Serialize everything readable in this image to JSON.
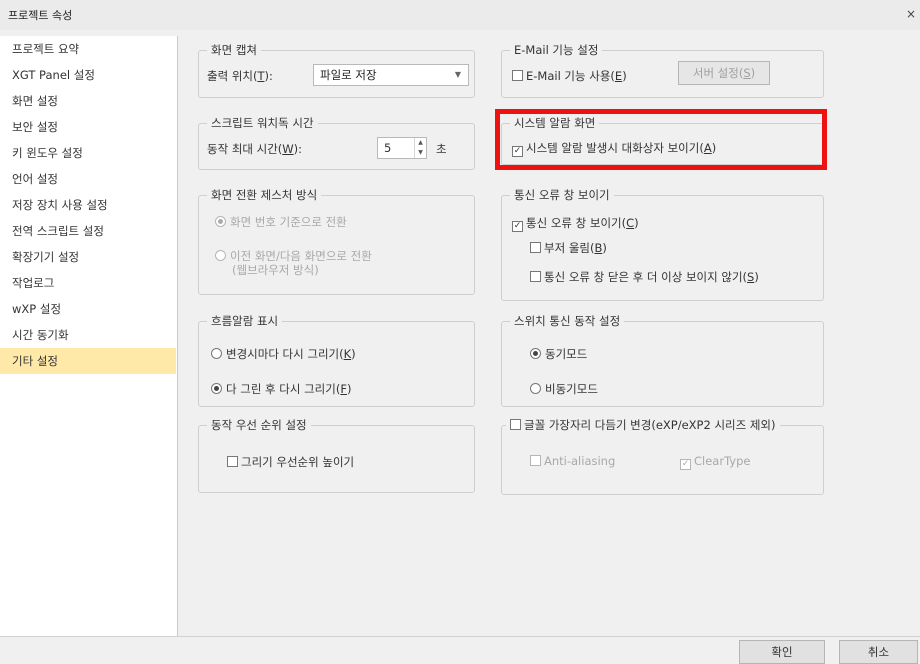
{
  "window": {
    "title": "프로젝트 속성",
    "close_glyph": "×"
  },
  "sidebar": {
    "items": [
      {
        "label": "프로젝트 요약"
      },
      {
        "label": "XGT Panel 설정"
      },
      {
        "label": "화면 설정"
      },
      {
        "label": "보안 설정"
      },
      {
        "label": "키 윈도우 설정"
      },
      {
        "label": "언어 설정"
      },
      {
        "label": "저장 장치 사용 설정"
      },
      {
        "label": "전역 스크립트 설정"
      },
      {
        "label": "확장기기 설정"
      },
      {
        "label": "작업로그"
      },
      {
        "label": "wXP 설정"
      },
      {
        "label": "시간 동기화"
      },
      {
        "label": "기타 설정",
        "selected": true
      }
    ]
  },
  "screen_capture": {
    "title": "화면 캡쳐",
    "output_label": "출력 위치(",
    "output_hotkey": "T",
    "output_suffix": "):",
    "output_value": "파일로 저장"
  },
  "email": {
    "title": "E-Mail 기능 설정",
    "use_label": "E-Mail 기능 사용(",
    "use_hotkey": "E",
    "use_suffix": ")",
    "server_button_label": "서버 설정(",
    "server_button_hotkey": "S",
    "server_button_suffix": ")"
  },
  "script_watchdog": {
    "title": "스크립트 워치독 시간",
    "max_time_label": "동작 최대 시간(",
    "max_time_hotkey": "W",
    "max_time_suffix": "):",
    "max_time_value": "5",
    "unit": "초"
  },
  "system_alarm": {
    "title": "시스템 알람 화면",
    "show_dialog_label": "시스템 알람 발생시 대화상자 보이기(",
    "show_dialog_hotkey": "A",
    "show_dialog_suffix": ")",
    "checked": true
  },
  "gesture": {
    "title": "화면 전환 제스처 방식",
    "option1": "화면 번호 기준으로 전환",
    "option2_line1": "이전 화면/다음 화면으로 전환",
    "option2_line2": "(웹브라우저 방식)"
  },
  "comm_error": {
    "title": "통신 오류 창 보이기",
    "show_label": "통신 오류 창 보이기(",
    "show_hotkey": "C",
    "show_suffix": ")",
    "buzzer_label": "부저 울림(",
    "buzzer_hotkey": "B",
    "buzzer_suffix": ")",
    "hide_label": "통신 오류 창 닫은 후 더 이상 보이지 않기(",
    "hide_hotkey": "S",
    "hide_suffix": ")"
  },
  "flow_alarm": {
    "title": "흐름알람 표시",
    "option1_label": "변경시마다 다시 그리기(",
    "option1_hotkey": "K",
    "option1_suffix": ")",
    "option2_label": "다 그린 후 다시 그리기(",
    "option2_hotkey": "F",
    "option2_suffix": ")"
  },
  "switch_comm": {
    "title": "스위치 통신 동작 설정",
    "option1": "동기모드",
    "option2": "비동기모드"
  },
  "priority": {
    "title": "동작 우선 순위 설정",
    "raise_label": "그리기 우선순위 높이기"
  },
  "font_smooth": {
    "title_label": "글꼴 가장자리 다듬기 변경(eXP/eXP2 시리즈 제외)",
    "anti_aliasing": "Anti-aliasing",
    "clear_type": "ClearType"
  },
  "footer": {
    "ok_label": "확인",
    "cancel_label": "취소"
  },
  "colors": {
    "highlight": "#ee1111",
    "selected_nav": "#ffe9a8"
  }
}
